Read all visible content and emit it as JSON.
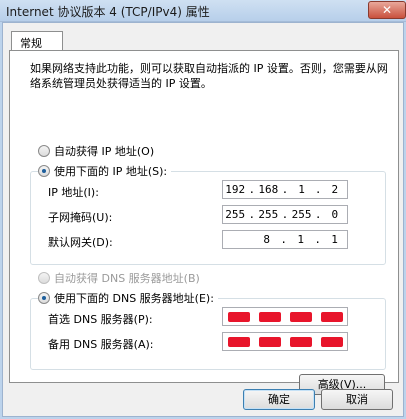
{
  "window": {
    "title": "Internet 协议版本 4 (TCP/IPv4) 属性",
    "close_label": "✕"
  },
  "tab": {
    "label": "常规"
  },
  "description": "如果网络支持此功能，则可以获取自动指派的 IP 设置。否则，您需要从网络系统管理员处获得适当的 IP 设置。",
  "ip_section": {
    "auto_label": "自动获得 IP 地址(O)",
    "manual_label": "使用下面的 IP 地址(S):",
    "fields": [
      {
        "label": "IP 地址(I):",
        "octets": [
          "192",
          "168",
          "1",
          "2"
        ]
      },
      {
        "label": "子网掩码(U):",
        "octets": [
          "255",
          "255",
          "255",
          "0"
        ]
      },
      {
        "label": "默认网关(D):",
        "octets": [
          "",
          "8",
          "1",
          "1"
        ]
      }
    ]
  },
  "dns_section": {
    "auto_label": "自动获得 DNS 服务器地址(B)",
    "manual_label": "使用下面的 DNS 服务器地址(E):",
    "fields": [
      {
        "label": "首选 DNS 服务器(P):"
      },
      {
        "label": "备用 DNS 服务器(A):"
      }
    ]
  },
  "buttons": {
    "advanced": "高级(V)...",
    "ok": "确定",
    "cancel": "取消"
  },
  "colors": {
    "redaction": "#e8152b"
  }
}
